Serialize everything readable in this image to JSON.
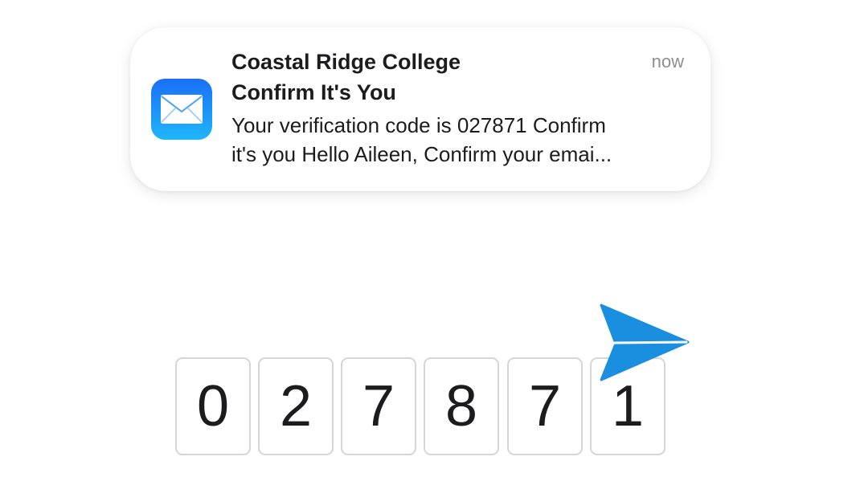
{
  "notification": {
    "app_name": "Coastal Ridge College",
    "time": "now",
    "subject": "Confirm It's You",
    "body_line1": "Your verification code is 027871 Confirm",
    "body_line2": "it's you Hello Aileen, Confirm your emai...",
    "icon": "mail-icon",
    "icon_gradient_top": "#1a6ff5",
    "icon_gradient_bottom": "#1fb6f8"
  },
  "code": {
    "digits": [
      "0",
      "2",
      "7",
      "8",
      "7",
      "1"
    ]
  },
  "send_icon": {
    "icon": "paper-plane-icon",
    "color": "#1a8fe0"
  }
}
